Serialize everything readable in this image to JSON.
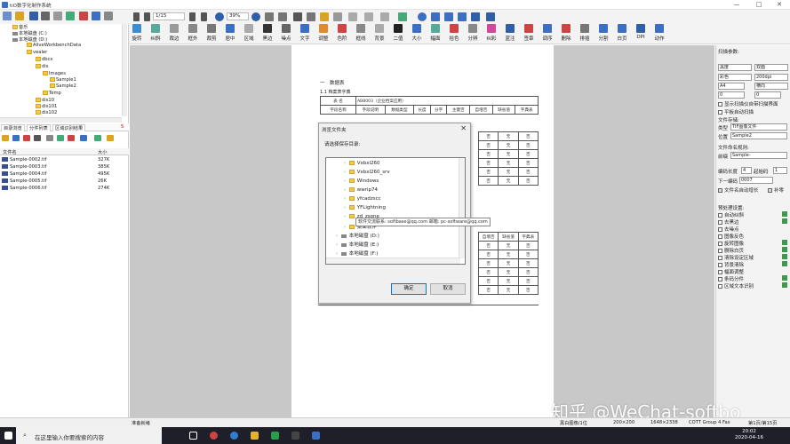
{
  "window": {
    "title": "tiO数字化制作系统"
  },
  "toolbar": {
    "page_indicator": "1/15",
    "zoom": "39%",
    "buttons": [
      "旋转",
      "纠斜",
      "裁边",
      "框外",
      "裁剪",
      "居中",
      "区域",
      "黑边",
      "噪点",
      "文字",
      "调整",
      "色阶",
      "框线",
      "背景",
      "二值",
      "大小",
      "幅面",
      "拾色",
      "分辨",
      "纠彩",
      "蓝注",
      "签章",
      "调序",
      "删除",
      "排插",
      "分割",
      "白页",
      "DPI",
      "动作"
    ]
  },
  "left_panel": {
    "tree": [
      {
        "label": "音乐",
        "type": "folder"
      },
      {
        "label": "本地磁盘 (C:)",
        "type": "drive"
      },
      {
        "label": "本地磁盘 (D:)",
        "type": "drive"
      },
      {
        "label": "AliveWorkbenchData",
        "type": "folder"
      },
      {
        "label": "vealer",
        "type": "folder"
      },
      {
        "label": "dbcs",
        "type": "folder"
      },
      {
        "label": "dis",
        "type": "folder"
      },
      {
        "label": "Images",
        "type": "folder"
      },
      {
        "label": "Sample1",
        "type": "folder"
      },
      {
        "label": "Sample2",
        "type": "folder"
      },
      {
        "label": "Temp",
        "type": "folder"
      },
      {
        "label": "dis10",
        "type": "folder"
      },
      {
        "label": "dis101",
        "type": "folder"
      },
      {
        "label": "dis102",
        "type": "folder"
      }
    ],
    "tabs": [
      "目录浏览",
      "分件列表",
      "区域识别结果"
    ],
    "tab_count": "5",
    "list_headers": {
      "name": "文件名",
      "size": "大小"
    },
    "files": [
      {
        "name": "Sample-0002.tif",
        "size": "327K"
      },
      {
        "name": "Sample-0003.tif",
        "size": "385K"
      },
      {
        "name": "Sample-0004.tif",
        "size": "495K"
      },
      {
        "name": "Sample-0005.tif",
        "size": "26K"
      },
      {
        "name": "Sample-0006.tif",
        "size": "274K"
      }
    ]
  },
  "document": {
    "heading": "一　数据表",
    "subheading": "1.1 档案表字典",
    "table_name_label": "表 名",
    "table_name_value": "AB8003（企业档案应用）",
    "columns": [
      "字段名称",
      "字段说明",
      "数据类型",
      "长度",
      "分字",
      "主键否",
      "自增否",
      "缺省值",
      "字典表"
    ],
    "right_columns": [
      "自增否",
      "缺省值",
      "字典表"
    ],
    "cell_values": [
      "否",
      "无",
      "否"
    ]
  },
  "dialog": {
    "title": "浏览文件夹",
    "prompt": "请选择保存目录:",
    "items": [
      {
        "label": "Vxbxl260",
        "type": "folder"
      },
      {
        "label": "Vxbxl260_srv",
        "type": "folder"
      },
      {
        "label": "Windows",
        "type": "folder"
      },
      {
        "label": "wwrip74",
        "type": "folder"
      },
      {
        "label": "yfcadzscc",
        "type": "folder"
      },
      {
        "label": "YFLightning",
        "type": "folder"
      },
      {
        "label": "zd_zsone",
        "type": "folder"
      },
      {
        "label": "桌面软件",
        "type": "folder"
      },
      {
        "label": "本地磁盘 (D:)",
        "type": "drive"
      },
      {
        "label": "本地磁盘 (E:)",
        "type": "drive"
      },
      {
        "label": "本地磁盘 (F:)",
        "type": "drive"
      }
    ],
    "ok": "确定",
    "cancel": "取消",
    "tooltip": "软件交流联系: softbase@qq.com 邮箱: pc-software@qq.com"
  },
  "right_panel": {
    "scan_params_title": "扫描参数:",
    "mode": "黑度",
    "duplex": "双面",
    "color": "彩色",
    "dpi": "200dpi",
    "paper": "A4",
    "orientation": "横向",
    "val1": "0",
    "val2": "0",
    "opt_auto_dup": "显示扫描仪自带扫描界面",
    "opt_flat": "平板自动扫描",
    "file_format_title": "文件存储:",
    "type_label": "类型",
    "type_value": "TIF图像文件",
    "location_label": "位置",
    "location_value": "Sample2",
    "naming_title": "文件命名规则:",
    "prefix_label": "前缀",
    "prefix_value": "Sample-",
    "code_length_label": "编码长度",
    "code_length_value": "4",
    "start_label": "起始码",
    "start_value": "1",
    "next_label": "下一编码",
    "next_value": "0007",
    "opt_auto_grow": "文件名自动增长",
    "opt_supplement": "补零",
    "preprocess_title": "预处理设置:",
    "preprocess_items": [
      "自动纠斜",
      "去黑边",
      "去噪点",
      "图像反色",
      "旋转图像",
      "删除白页",
      "清除设定区域",
      "背景清除",
      "幅面调整",
      "条码分件",
      "区域文本识别"
    ],
    "preprocess_checked": [
      false,
      false,
      false,
      false,
      false,
      false,
      false,
      false,
      false,
      false,
      false
    ]
  },
  "status": {
    "left": "准备就绪",
    "color_mode": "黑白图像/1位",
    "dpi": "200×200",
    "size": "1648×2338",
    "company": "COTT Group 4 Fax",
    "page": "第1页/第15页"
  },
  "taskbar": {
    "search_placeholder": "在这里输入你要搜索的内容",
    "time": "20:02",
    "date": "2020-04-16"
  },
  "watermark": "知乎 @WeChat-softbo"
}
